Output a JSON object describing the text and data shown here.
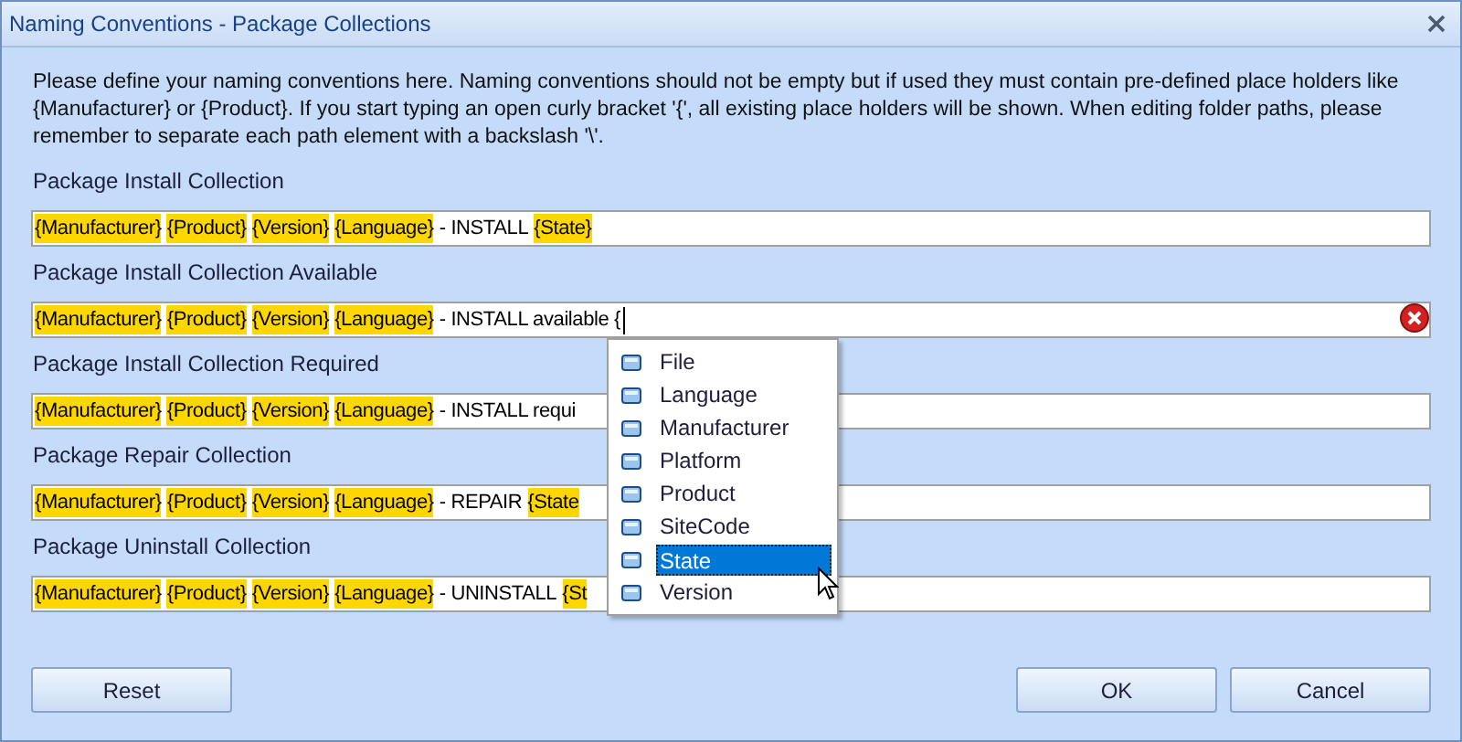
{
  "window": {
    "title": "Naming Conventions - Package Collections"
  },
  "description": "Please define your naming conventions here. Naming conventions should not be empty but if used they must contain pre-defined place holders like {Manufacturer} or {Product}. If you start typing an open curly bracket '{', all existing place holders will be shown. When editing folder paths, please remember to separate each path element with a backslash '\\'.",
  "fields": [
    {
      "label": "Package Install Collection",
      "error": false,
      "caret": false,
      "segments": [
        {
          "kind": "token",
          "text": "{Manufacturer}"
        },
        {
          "kind": "token",
          "text": "{Product}"
        },
        {
          "kind": "token",
          "text": "{Version}"
        },
        {
          "kind": "token",
          "text": "{Language}"
        },
        {
          "kind": "text",
          "text": "- INSTALL"
        },
        {
          "kind": "token",
          "text": "{State}"
        }
      ]
    },
    {
      "label": "Package Install Collection Available",
      "error": true,
      "caret": true,
      "segments": [
        {
          "kind": "token",
          "text": "{Manufacturer}"
        },
        {
          "kind": "token",
          "text": "{Product}"
        },
        {
          "kind": "token",
          "text": "{Version}"
        },
        {
          "kind": "token",
          "text": "{Language}"
        },
        {
          "kind": "text",
          "text": "- INSTALL available {"
        }
      ]
    },
    {
      "label": "Package Install Collection Required",
      "error": false,
      "caret": false,
      "segments": [
        {
          "kind": "token",
          "text": "{Manufacturer}"
        },
        {
          "kind": "token",
          "text": "{Product}"
        },
        {
          "kind": "token",
          "text": "{Version}"
        },
        {
          "kind": "token",
          "text": "{Language}"
        },
        {
          "kind": "text",
          "text": "- INSTALL requi"
        }
      ]
    },
    {
      "label": "Package Repair Collection",
      "error": false,
      "caret": false,
      "segments": [
        {
          "kind": "token",
          "text": "{Manufacturer}"
        },
        {
          "kind": "token",
          "text": "{Product}"
        },
        {
          "kind": "token",
          "text": "{Version}"
        },
        {
          "kind": "token",
          "text": "{Language}"
        },
        {
          "kind": "text",
          "text": "- REPAIR"
        },
        {
          "kind": "token",
          "text": "{State"
        }
      ]
    },
    {
      "label": "Package Uninstall Collection",
      "error": false,
      "caret": false,
      "segments": [
        {
          "kind": "token",
          "text": "{Manufacturer}"
        },
        {
          "kind": "token",
          "text": "{Product}"
        },
        {
          "kind": "token",
          "text": "{Version}"
        },
        {
          "kind": "token",
          "text": "{Language}"
        },
        {
          "kind": "text",
          "text": "- UNINSTALL"
        },
        {
          "kind": "token",
          "text": "{St"
        }
      ]
    }
  ],
  "suggestions": [
    {
      "label": "File",
      "selected": false
    },
    {
      "label": "Language",
      "selected": false
    },
    {
      "label": "Manufacturer",
      "selected": false
    },
    {
      "label": "Platform",
      "selected": false
    },
    {
      "label": "Product",
      "selected": false
    },
    {
      "label": "SiteCode",
      "selected": false
    },
    {
      "label": "State",
      "selected": true
    },
    {
      "label": "Version",
      "selected": false
    }
  ],
  "buttons": {
    "reset": "Reset",
    "ok": "OK",
    "cancel": "Cancel"
  }
}
